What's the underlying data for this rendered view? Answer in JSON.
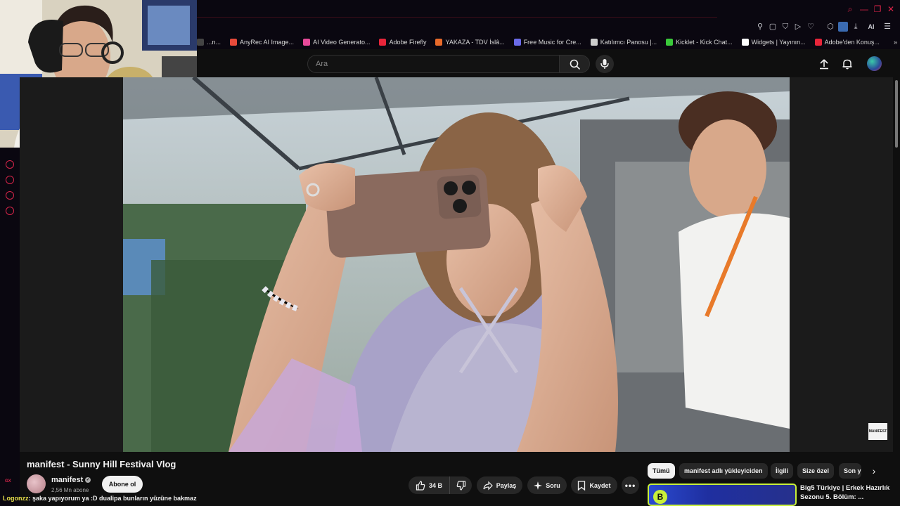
{
  "browser": {
    "bookmarks": [
      {
        "label": "...n...",
        "color": "#666"
      },
      {
        "label": "AnyRec AI Image...",
        "color": "#e84a3a"
      },
      {
        "label": "AI Video Generato...",
        "color": "#e84a9a"
      },
      {
        "label": "Adobe Firefly",
        "color": "#e8253a"
      },
      {
        "label": "YAKAZA - TDV İslâ...",
        "color": "#e86a2a"
      },
      {
        "label": "Free Music for Cre...",
        "color": "#6a6ae8"
      },
      {
        "label": "Katılımcı Panosu |...",
        "color": "#cccccc"
      },
      {
        "label": "Kicklet - Kick Chat...",
        "color": "#3ac83a"
      },
      {
        "label": "Widgets | Yayının...",
        "color": "#ffffff"
      },
      {
        "label": "Adobe'den Konuş...",
        "color": "#e8253a"
      }
    ],
    "ai_label": "AI",
    "gx_label": "GX"
  },
  "header": {
    "search_placeholder": "Ara"
  },
  "video": {
    "title": "manifest - Sunny Hill Festival Vlog",
    "watermark": "MANIFEST"
  },
  "channel": {
    "name": "manifest",
    "subscribers": "2,56 Mn abone",
    "subscribe_label": "Abone ol"
  },
  "actions": {
    "likes": "34 B",
    "share": "Paylaş",
    "ask": "Soru",
    "save": "Kaydet"
  },
  "chat": {
    "user": "Logonzz",
    "message": ": şaka yapıyorum ya :D dualipa bunların yüzüne bakmaz"
  },
  "chips": [
    {
      "label": "Tümü",
      "active": true
    },
    {
      "label": "manifest adlı yükleyiciden",
      "active": false
    },
    {
      "label": "İlgili",
      "active": false
    },
    {
      "label": "Size özel",
      "active": false
    },
    {
      "label": "Son y",
      "active": false
    }
  ],
  "recommendation": {
    "title": "Big5 Türkiye | Erkek Hazırlık Sezonu 5. Bölüm: ..."
  },
  "colors": {
    "opera_accent": "#e0254a",
    "yt_bg": "#0f0f0f",
    "pill_bg": "#272727"
  }
}
